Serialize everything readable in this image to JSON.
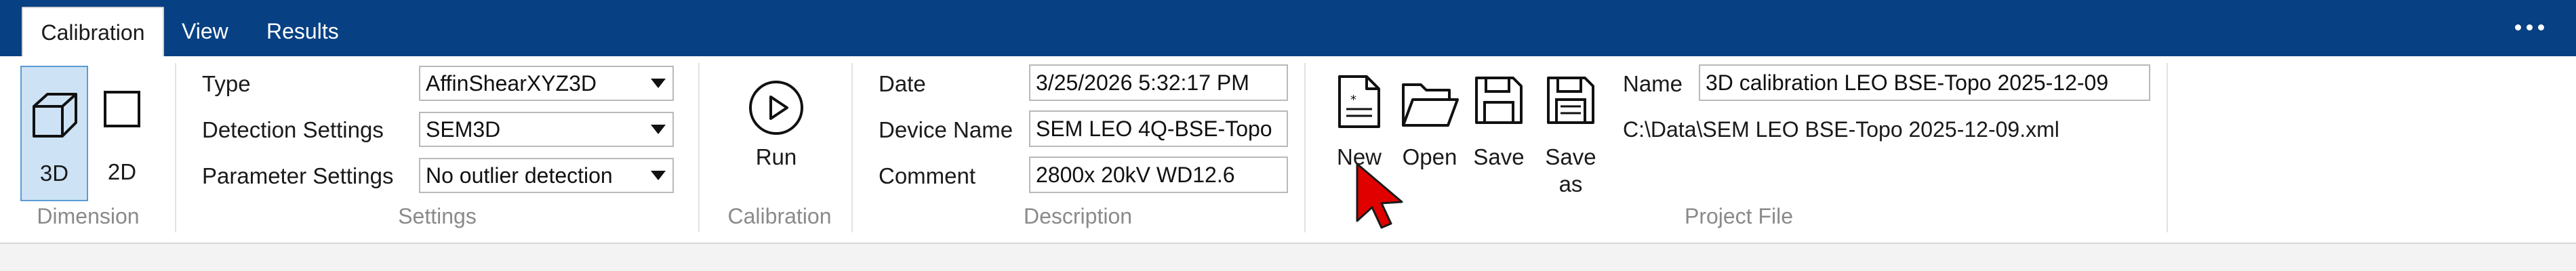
{
  "tabs": [
    {
      "label": "Calibration",
      "active": true
    },
    {
      "label": "View",
      "active": false
    },
    {
      "label": "Results",
      "active": false
    }
  ],
  "dimension": {
    "group_label": "Dimension",
    "btn_3d": "3D",
    "btn_2d": "2D",
    "selected": "3D"
  },
  "settings": {
    "group_label": "Settings",
    "type_label": "Type",
    "type_value": "AffinShearXYZ3D",
    "detection_label": "Detection Settings",
    "detection_value": "SEM3D",
    "parameter_label": "Parameter Settings",
    "parameter_value": "No outlier detection"
  },
  "calibration": {
    "group_label": "Calibration",
    "run_label": "Run"
  },
  "description": {
    "group_label": "Description",
    "date_label": "Date",
    "date_value": "3/25/2026 5:32:17 PM",
    "device_label": "Device Name",
    "device_value": "SEM LEO 4Q-BSE-Topo",
    "comment_label": "Comment",
    "comment_value": "2800x 20kV WD12.6"
  },
  "project_file": {
    "group_label": "Project File",
    "new_label": "New",
    "open_label": "Open",
    "save_label": "Save",
    "save_as_line1": "Save",
    "save_as_line2": "as",
    "name_label": "Name",
    "name_value": "3D calibration LEO BSE-Topo 2025-12-09",
    "path": "C:\\Data\\SEM LEO BSE-Topo 2025-12-09.xml"
  },
  "colors": {
    "tabbar": "#074083",
    "selected_fill": "#cde3f5",
    "selected_border": "#5a9bd5",
    "cursor": "#e00000"
  }
}
